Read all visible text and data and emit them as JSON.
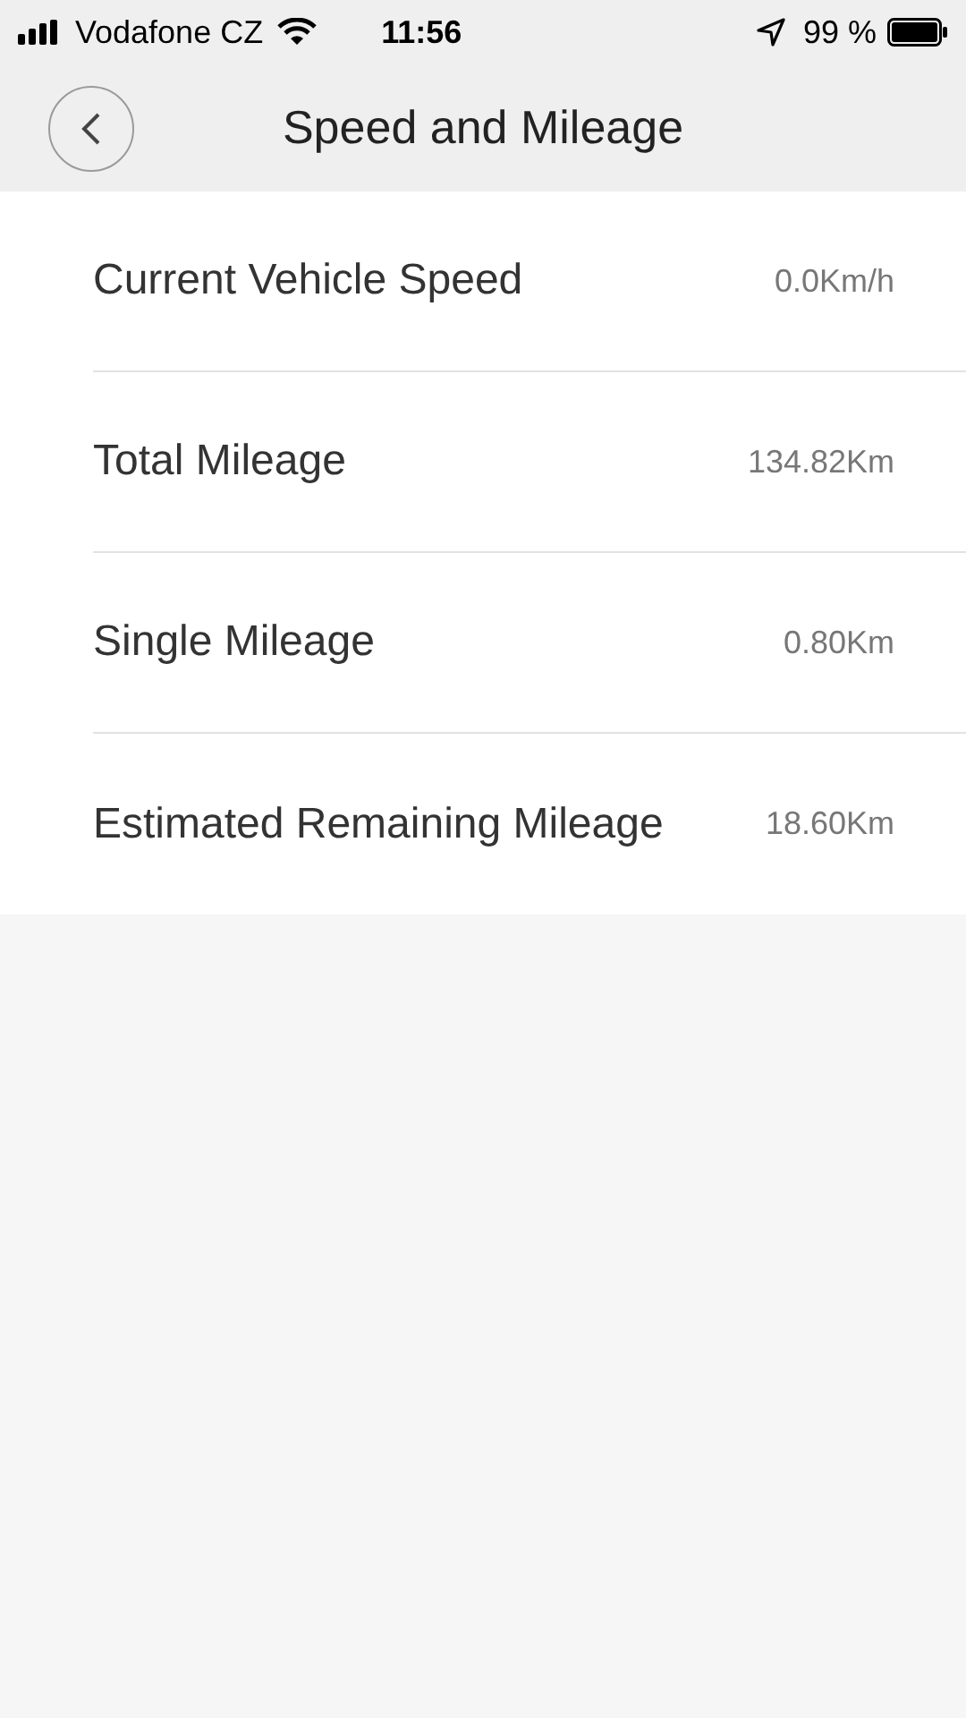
{
  "status_bar": {
    "carrier": "Vodafone CZ",
    "time": "11:56",
    "battery": "99 %"
  },
  "header": {
    "title": "Speed and Mileage"
  },
  "rows": [
    {
      "label": "Current Vehicle Speed",
      "value": "0.0Km/h"
    },
    {
      "label": "Total Mileage",
      "value": "134.82Km"
    },
    {
      "label": "Single Mileage",
      "value": "0.80Km"
    },
    {
      "label": "Estimated Remaining Mileage",
      "value": "18.60Km"
    }
  ]
}
